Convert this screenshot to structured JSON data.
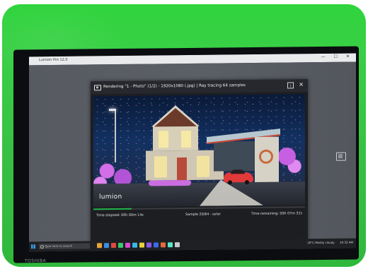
{
  "app_window": {
    "title": "Lumion Pro 12.0",
    "controls": "— ☐ ✕"
  },
  "render_dialog": {
    "title": "Rendering \"1 - Photo\" (1/2) - 1920x1080 (.jpg) | Ray tracing 64 samples",
    "info_icon": "i",
    "close_icon": "✕",
    "logo_text": "lumion",
    "progress_fraction": 0.18,
    "progress_color": "#21b24a",
    "time_elapsed": "Time elapsed: 00h 00m 14s",
    "sample": "Sample 20/64 - solar",
    "time_remaining": "Time remaining: 00h 07m 31s"
  },
  "taskbar": {
    "search_placeholder": "Type here to search",
    "tray_weather": "18°C  Mostly cloudy",
    "tray_time": "10:32 AM"
  },
  "monitor": {
    "brand": "TOSHIBA"
  },
  "colors": {
    "backdrop": "#37bf44",
    "accent": "#21b24a"
  },
  "icons": [
    "camera-icon",
    "info-icon",
    "close-icon",
    "windows-start-icon",
    "search-icon",
    "taskbar-app-icon",
    "side-panel-icon"
  ]
}
